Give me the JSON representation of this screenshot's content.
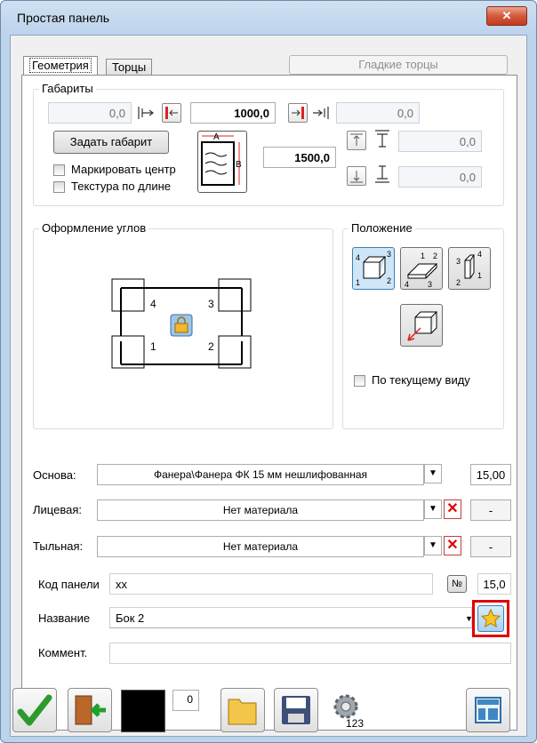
{
  "window": {
    "title": "Простая панель",
    "close_glyph": "✕"
  },
  "tabs": [
    {
      "label": "Геометрия"
    },
    {
      "label": "Торцы"
    }
  ],
  "smooth_edges_button": "Гладкие торцы",
  "dimensions": {
    "group_title": "Габариты",
    "left_offset": "0,0",
    "width": "1000,0",
    "right_offset": "0,0",
    "set_size_button": "Задать габарит",
    "height": "1500,0",
    "top_offset": "0,0",
    "bottom_offset": "0,0",
    "mark_center_label": "Маркировать центр",
    "texture_length_label": "Текстура по длине",
    "diagram_a": "A",
    "diagram_b": "B"
  },
  "corners": {
    "group_title": "Оформление углов",
    "corner_labels": [
      "4",
      "3",
      "1",
      "2"
    ]
  },
  "position": {
    "group_title": "Положение",
    "by_view_label": "По текущему виду",
    "orient1_labels": [
      "4",
      "3",
      "1",
      "2"
    ],
    "orient2_labels": [
      "1",
      "2",
      "4",
      "3"
    ],
    "orient3_labels": [
      "3",
      "4",
      "2",
      "1"
    ]
  },
  "materials": {
    "base_label": "Основа:",
    "base_value": "Фанера\\Фанера ФК 15 мм нешлифованная",
    "base_thickness": "15,00",
    "face_label": "Лицевая:",
    "face_value": "Нет материала",
    "face_thickness": "-",
    "back_label": "Тыльная:",
    "back_value": "Нет материала",
    "back_thickness": "-"
  },
  "panel": {
    "code_label": "Код панели",
    "code_value": "xx",
    "number_button": "№",
    "thickness": "15,0",
    "name_label": "Название",
    "name_value": "Бок 2",
    "comment_label": "Коммент.",
    "comment_value": ""
  },
  "toolbar": {
    "counter": "0",
    "calc_label": "123"
  },
  "colors": {
    "accent_red": "#e00000",
    "title_bg": "#bcd3ec",
    "swatch": "#000000"
  }
}
